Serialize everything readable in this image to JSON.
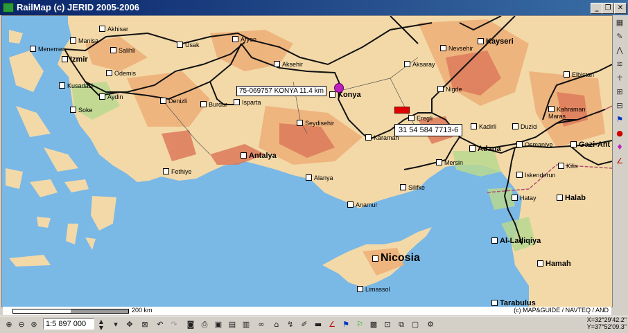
{
  "window": {
    "title": "RailMap (c) JERID 2005-2006",
    "minimize": "_",
    "restore": "❐",
    "close": "✕"
  },
  "map": {
    "colors": {
      "sea": "#7ab8e6",
      "lowland": "#f3d9a8",
      "hills": "#eeb07a",
      "mountains": "#dd7a5a",
      "green": "#b8d890",
      "rail": "#111111"
    },
    "cities": [
      {
        "name": "Akhisar"
      },
      {
        "name": "Manisa"
      },
      {
        "name": "Menemen"
      },
      {
        "name": "Salihli"
      },
      {
        "name": "Izmir"
      },
      {
        "name": "Usak"
      },
      {
        "name": "Afyon"
      },
      {
        "name": "Odemis"
      },
      {
        "name": "Kusadasi"
      },
      {
        "name": "Aydin"
      },
      {
        "name": "Soke"
      },
      {
        "name": "Denizli"
      },
      {
        "name": "Aksehir"
      },
      {
        "name": "Burdur"
      },
      {
        "name": "Isparta"
      },
      {
        "name": "Konya"
      },
      {
        "name": "Seydisehir"
      },
      {
        "name": "Nevsehir"
      },
      {
        "name": "Kayseri"
      },
      {
        "name": "Aksaray"
      },
      {
        "name": "Nigde"
      },
      {
        "name": "Elbistan"
      },
      {
        "name": "Karaman"
      },
      {
        "name": "Eregli"
      },
      {
        "name": "Kadirli"
      },
      {
        "name": "Duzici"
      },
      {
        "name": "Kahraman Maras"
      },
      {
        "name": "Adana"
      },
      {
        "name": "Osmaniye"
      },
      {
        "name": "Gazi-Ant"
      },
      {
        "name": "Mersin"
      },
      {
        "name": "Kilis"
      },
      {
        "name": "Antalya"
      },
      {
        "name": "Fethiye"
      },
      {
        "name": "Alanya"
      },
      {
        "name": "Silifke"
      },
      {
        "name": "Iskenderun"
      },
      {
        "name": "Anamur"
      },
      {
        "name": "Hatay"
      },
      {
        "name": "Halab"
      },
      {
        "name": "Al-Ladiqiya"
      },
      {
        "name": "Nicosia"
      },
      {
        "name": "Hamah"
      },
      {
        "name": "Limassol"
      },
      {
        "name": "Tarabulus"
      }
    ],
    "callouts": {
      "konya": "75-069757 KONYA 11.4 km",
      "eregli": "31 54 584 7713-6"
    }
  },
  "scalebar": {
    "label": "200 km",
    "copyright": "(c) MAP&GUIDE / NAVTEQ / AND"
  },
  "toolbar": {
    "scale_value": "1:5 897 000"
  },
  "coords": {
    "x": "X=32°29'42.2\"",
    "y": "Y=37°52'09.3\""
  }
}
